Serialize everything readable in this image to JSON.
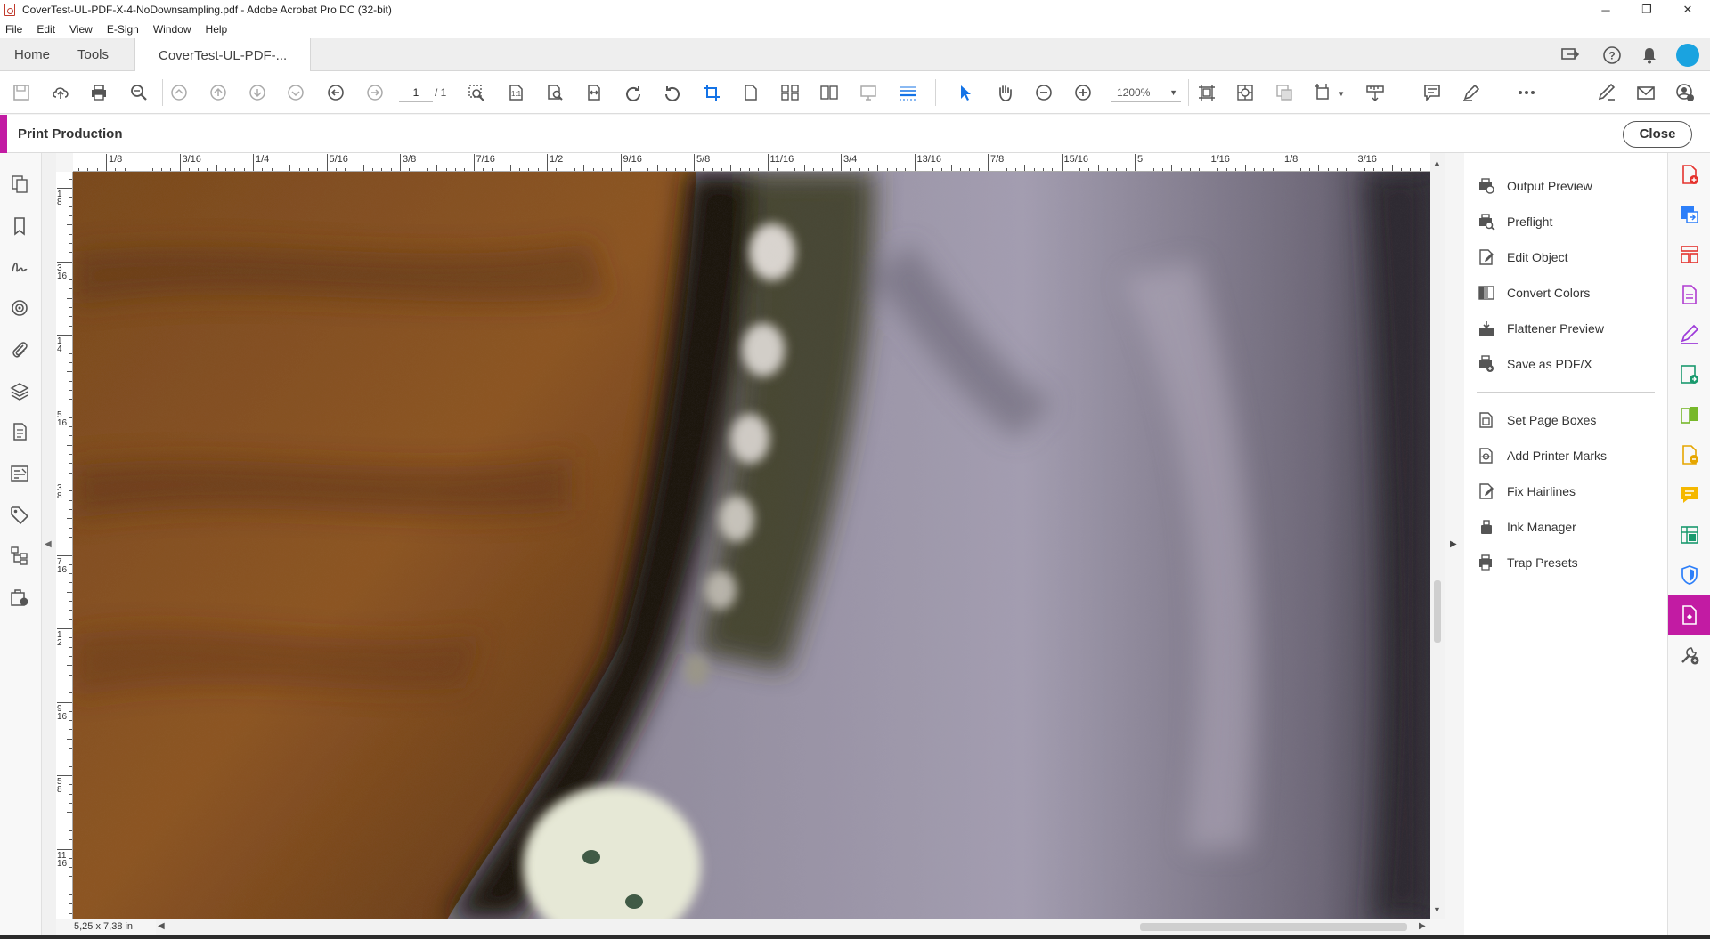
{
  "window": {
    "title": "CoverTest-UL-PDF-X-4-NoDownsampling.pdf - Adobe Acrobat Pro DC (32-bit)",
    "controls": {
      "minimize": "─",
      "restore": "❐",
      "close": "✕"
    }
  },
  "menu": [
    "File",
    "Edit",
    "View",
    "E-Sign",
    "Window",
    "Help"
  ],
  "tabs": {
    "home": "Home",
    "tools": "Tools",
    "document": "CoverTest-UL-PDF-..."
  },
  "toolbar": {
    "page_current": "1",
    "page_total": "/ 1",
    "zoom": "1200%"
  },
  "tool_panel": {
    "title": "Print Production",
    "close_label": "Close",
    "group1": [
      {
        "label": "Output Preview",
        "icon": "output-preview-icon"
      },
      {
        "label": "Preflight",
        "icon": "preflight-icon"
      },
      {
        "label": "Edit Object",
        "icon": "edit-object-icon"
      },
      {
        "label": "Convert Colors",
        "icon": "convert-colors-icon"
      },
      {
        "label": "Flattener Preview",
        "icon": "flattener-preview-icon"
      },
      {
        "label": "Save as PDF/X",
        "icon": "save-pdfx-icon"
      }
    ],
    "group2": [
      {
        "label": "Set Page Boxes",
        "icon": "page-boxes-icon"
      },
      {
        "label": "Add Printer Marks",
        "icon": "printer-marks-icon"
      },
      {
        "label": "Fix Hairlines",
        "icon": "hairlines-icon"
      },
      {
        "label": "Ink Manager",
        "icon": "ink-manager-icon"
      },
      {
        "label": "Trap Presets",
        "icon": "trap-presets-icon"
      }
    ]
  },
  "ruler": {
    "top_labels": [
      "1/8",
      "3/16",
      "1/4",
      "5/16",
      "3/8",
      "7/16",
      "1/2",
      "9/16",
      "5/8",
      "11/16",
      "3/4",
      "13/16",
      "7/8",
      "15/16",
      "5",
      "1/16",
      "1/8",
      "3/16"
    ],
    "left_labels": [
      "1\n8",
      "3\n16",
      "1\n4",
      "5\n16",
      "3\n8",
      "7\n16",
      "1\n2",
      "9\n16",
      "5\n8",
      "11\n16"
    ]
  },
  "status": {
    "page_size": "5,25 x 7,38 in"
  },
  "colors": {
    "accent": "#c21ba3",
    "toolbar_blue": "#1473e6",
    "brown": "#7a4a1e",
    "fabric": "#8b8595"
  }
}
